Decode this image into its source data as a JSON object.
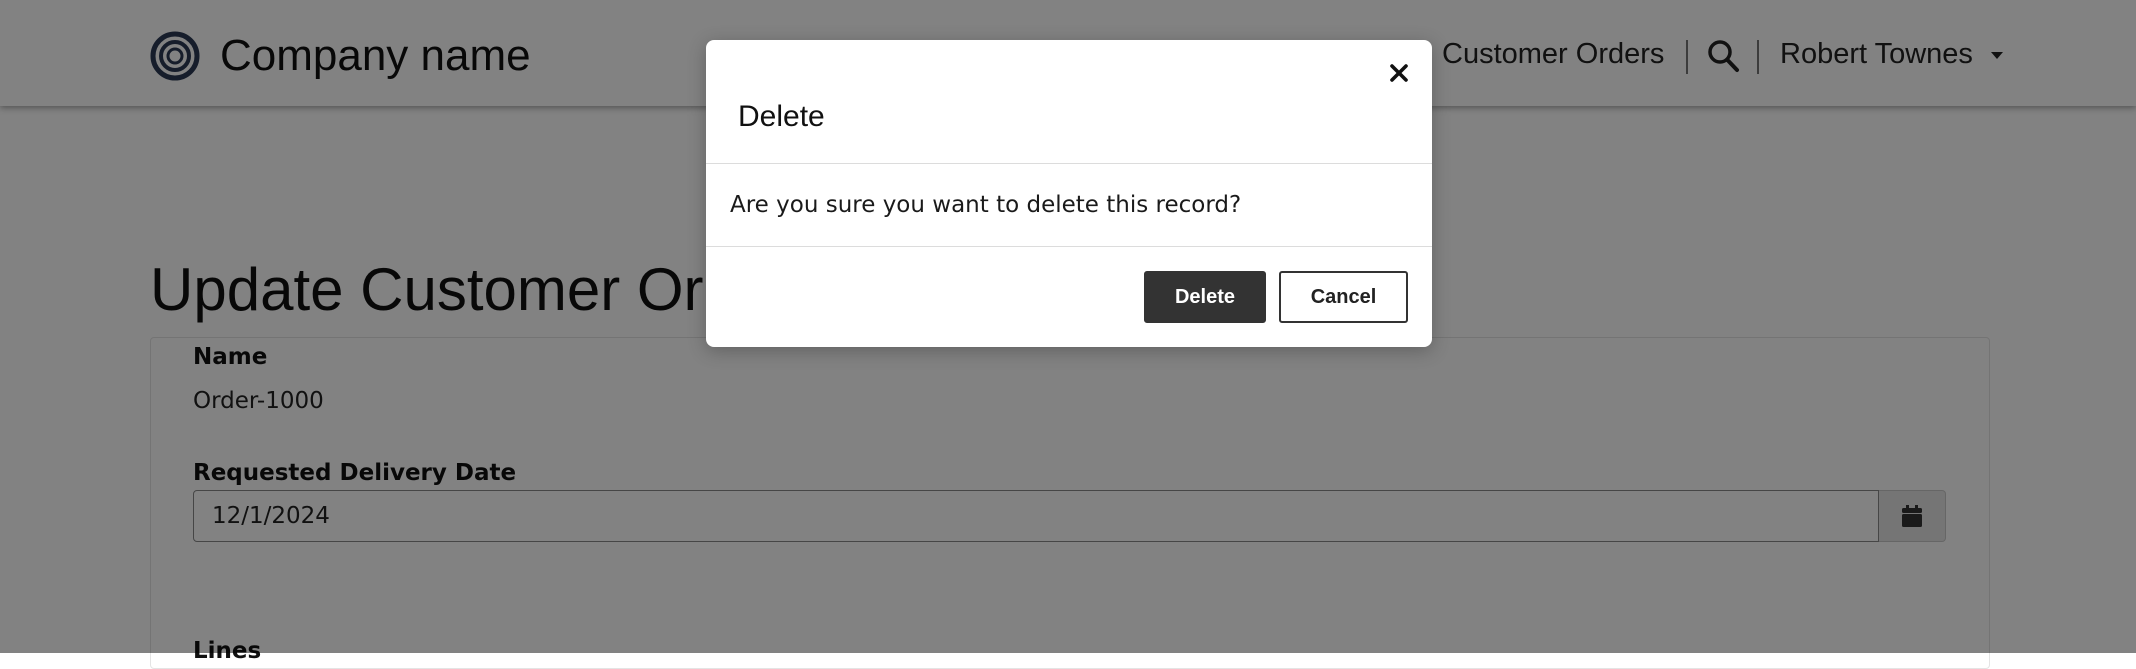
{
  "header": {
    "company_name": "Company name",
    "nav_link": "Customer Orders",
    "user_name": "Robert Townes",
    "icons": {
      "logo": "ring-logo-icon",
      "search": "search-icon",
      "user_menu": "chevron-down-icon"
    }
  },
  "page": {
    "title": "Update Customer Orders",
    "form": {
      "name_label": "Name",
      "name_value": "Order-1000",
      "date_label": "Requested Delivery Date",
      "date_value": "12/1/2024",
      "date_icon": "calendar-icon",
      "lines_label": "Lines"
    }
  },
  "modal": {
    "title": "Delete",
    "message": "Are you sure you want to delete this record?",
    "delete_label": "Delete",
    "cancel_label": "Cancel",
    "close_icon": "close-icon"
  },
  "colors": {
    "backdrop": "#000000",
    "primary_button": "#333333",
    "logo": "#2b3a55"
  }
}
